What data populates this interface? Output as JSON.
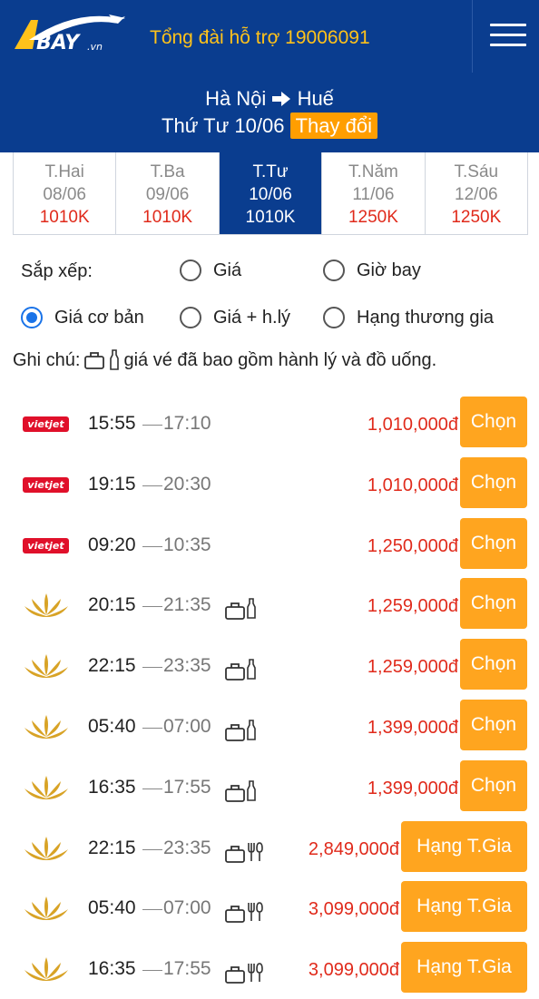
{
  "header": {
    "logo_text": "ABAY.vn",
    "hotline": "Tổng đài hỗ trợ 19006091",
    "menu_icon": "hamburger-menu-icon"
  },
  "route": {
    "from": "Hà Nội",
    "arrow_icon": "right-arrow-icon",
    "to": "Huế",
    "date": "Thứ Tư 10/06",
    "change": "Thay đổi"
  },
  "days": [
    {
      "name": "T.Hai",
      "date": "08/06",
      "price": "1010K",
      "active": false
    },
    {
      "name": "T.Ba",
      "date": "09/06",
      "price": "1010K",
      "active": false
    },
    {
      "name": "T.Tư",
      "date": "10/06",
      "price": "1010K",
      "active": true
    },
    {
      "name": "T.Năm",
      "date": "11/06",
      "price": "1250K",
      "active": false
    },
    {
      "name": "T.Sáu",
      "date": "12/06",
      "price": "1250K",
      "active": false
    }
  ],
  "sort": {
    "label": "Sắp xếp:",
    "options": [
      {
        "label": "Giá",
        "checked": false
      },
      {
        "label": "Giờ bay",
        "checked": false
      },
      {
        "label": "Giá cơ bản",
        "checked": true
      },
      {
        "label": "Giá + h.lý",
        "checked": false
      },
      {
        "label": "Hạng thương gia",
        "checked": false
      }
    ]
  },
  "note": {
    "prefix": "Ghi chú:",
    "text": "giá vé đã bao gồm hành lý và đồ uống."
  },
  "colors": {
    "header_bg": "#0a3d8f",
    "accent": "#ffa51f",
    "price": "#e02a1b"
  },
  "flights": [
    {
      "airline": "vietjet",
      "logo_text": "vietjet",
      "dep": "15:55",
      "arr": "17:10",
      "services": [],
      "price": "1,010,000đ",
      "button": "Chọn"
    },
    {
      "airline": "vietjet",
      "logo_text": "vietjet",
      "dep": "19:15",
      "arr": "20:30",
      "services": [],
      "price": "1,010,000đ",
      "button": "Chọn"
    },
    {
      "airline": "vietjet",
      "logo_text": "vietjet",
      "dep": "09:20",
      "arr": "10:35",
      "services": [],
      "price": "1,250,000đ",
      "button": "Chọn"
    },
    {
      "airline": "vietnam-airlines",
      "dep": "20:15",
      "arr": "21:35",
      "services": [
        "luggage",
        "bottle"
      ],
      "price": "1,259,000đ",
      "button": "Chọn"
    },
    {
      "airline": "vietnam-airlines",
      "dep": "22:15",
      "arr": "23:35",
      "services": [
        "luggage",
        "bottle"
      ],
      "price": "1,259,000đ",
      "button": "Chọn"
    },
    {
      "airline": "vietnam-airlines",
      "dep": "05:40",
      "arr": "07:00",
      "services": [
        "luggage",
        "bottle"
      ],
      "price": "1,399,000đ",
      "button": "Chọn"
    },
    {
      "airline": "vietnam-airlines",
      "dep": "16:35",
      "arr": "17:55",
      "services": [
        "luggage",
        "bottle"
      ],
      "price": "1,399,000đ",
      "button": "Chọn"
    },
    {
      "airline": "vietnam-airlines",
      "dep": "22:15",
      "arr": "23:35",
      "services": [
        "luggage",
        "meal"
      ],
      "price": "2,849,000đ",
      "button": "Hạng T.Gia"
    },
    {
      "airline": "vietnam-airlines",
      "dep": "05:40",
      "arr": "07:00",
      "services": [
        "luggage",
        "meal"
      ],
      "price": "3,099,000đ",
      "button": "Hạng T.Gia"
    },
    {
      "airline": "vietnam-airlines",
      "dep": "16:35",
      "arr": "17:55",
      "services": [
        "luggage",
        "meal"
      ],
      "price": "3,099,000đ",
      "button": "Hạng T.Gia"
    }
  ]
}
